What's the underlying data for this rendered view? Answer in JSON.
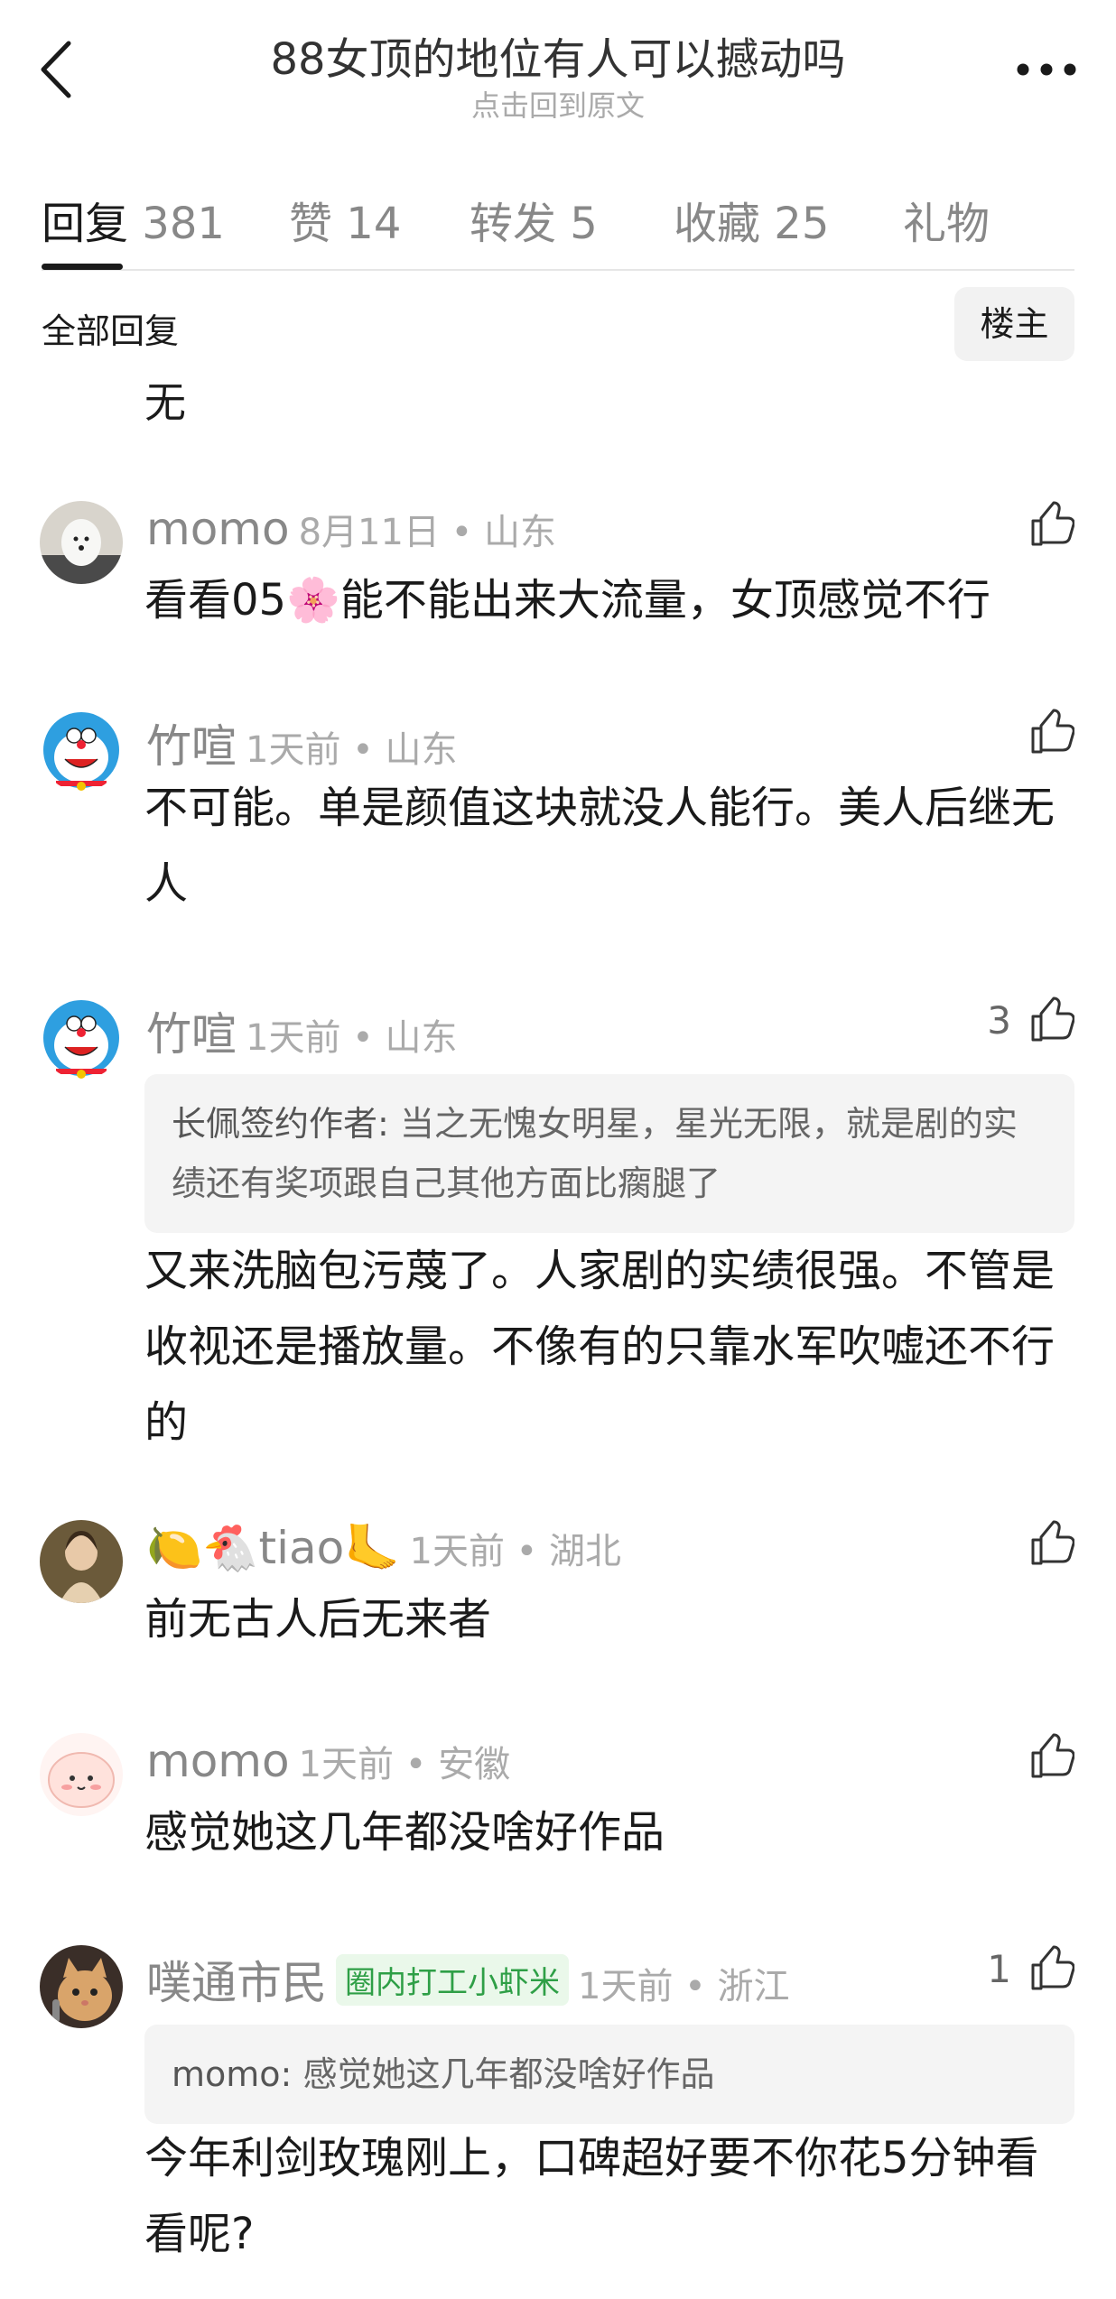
{
  "header": {
    "title": "88女顶的地位有人可以撼动吗",
    "subtitle": "点击回到原文"
  },
  "tabs": [
    {
      "label": "回复",
      "count": "381",
      "active": true
    },
    {
      "label": "赞",
      "count": "14"
    },
    {
      "label": "转发",
      "count": "5"
    },
    {
      "label": "收藏",
      "count": "25"
    },
    {
      "label": "礼物",
      "count": ""
    }
  ],
  "filter": {
    "label": "全部回复",
    "op_button": "楼主"
  },
  "truncated_text": "无",
  "comments": [
    {
      "user": "momo",
      "time": "8月11日 • 山东",
      "likes": "",
      "text": "看看05🌸能不能出来大流量，女顶感觉不行"
    },
    {
      "user": "竹喧",
      "time": "1天前 • 山东",
      "likes": "",
      "text": "不可能。单是颜值这块就没人能行。美人后继无人"
    },
    {
      "user": "竹喧",
      "time": "1天前 • 山东",
      "likes": "3",
      "quote_author": "长佩签约作者:",
      "quote_text": "当之无愧女明星，星光无限，就是剧的实绩还有奖项跟自己其他方面比瘸腿了",
      "text": "又来洗脑包污蔑了。人家剧的实绩很强。不管是收视还是播放量。不像有的只靠水军吹嘘还不行的"
    },
    {
      "user": "🍋🐔tiao🦶",
      "time": "1天前 • 湖北",
      "likes": "",
      "text": "前无古人后无来者"
    },
    {
      "user": "momo",
      "time": "1天前 • 安徽",
      "likes": "",
      "text": "感觉她这几年都没啥好作品"
    },
    {
      "user": "噗通市民",
      "badge": "圈内打工小虾米",
      "time": "1天前 • 浙江",
      "likes": "1",
      "quote_author": "momo:",
      "quote_text": "感觉她这几年都没啥好作品",
      "text": "今年利剑玫瑰刚上，口碑超好要不你花5分钟看看呢?"
    }
  ]
}
